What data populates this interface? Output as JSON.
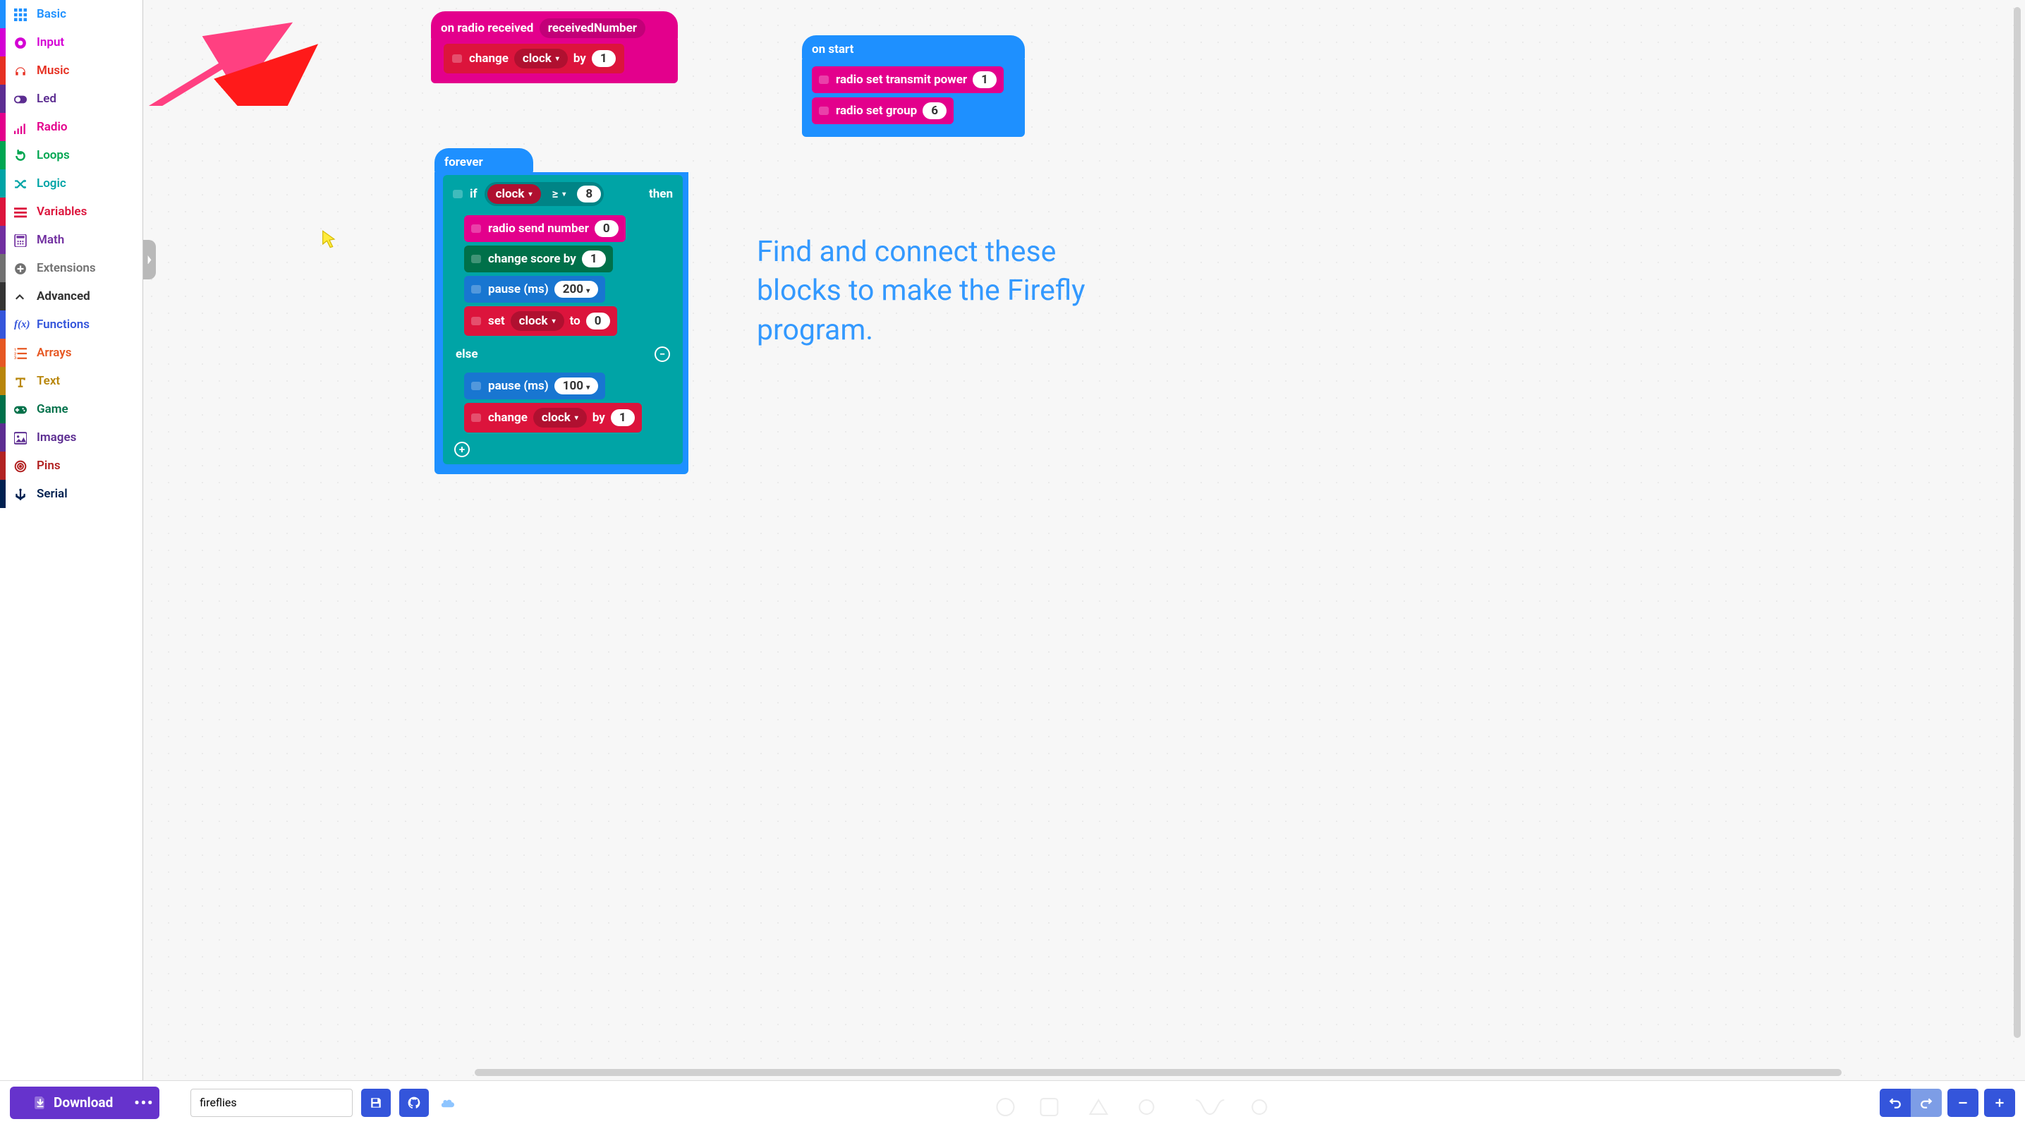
{
  "toolbox": [
    {
      "id": "basic",
      "label": "Basic"
    },
    {
      "id": "input",
      "label": "Input"
    },
    {
      "id": "music",
      "label": "Music"
    },
    {
      "id": "led",
      "label": "Led"
    },
    {
      "id": "radio",
      "label": "Radio"
    },
    {
      "id": "loops",
      "label": "Loops"
    },
    {
      "id": "logic",
      "label": "Logic"
    },
    {
      "id": "variables",
      "label": "Variables"
    },
    {
      "id": "math",
      "label": "Math"
    },
    {
      "id": "extensions",
      "label": "Extensions"
    },
    {
      "id": "advanced",
      "label": "Advanced"
    },
    {
      "id": "functions",
      "label": "Functions"
    },
    {
      "id": "arrays",
      "label": "Arrays"
    },
    {
      "id": "text",
      "label": "Text"
    },
    {
      "id": "game",
      "label": "Game"
    },
    {
      "id": "images",
      "label": "Images"
    },
    {
      "id": "pins",
      "label": "Pins"
    },
    {
      "id": "serial",
      "label": "Serial"
    }
  ],
  "blocks": {
    "onRadio": {
      "title": "on radio received",
      "param": "receivedNumber",
      "change": {
        "label": "change",
        "var": "clock",
        "by": "by",
        "val": "1"
      }
    },
    "onStart": {
      "title": "on start",
      "rows": [
        {
          "label": "radio set transmit power",
          "val": "1"
        },
        {
          "label": "radio set group",
          "val": "6"
        }
      ]
    },
    "forever": {
      "title": "forever",
      "if": "if",
      "then": "then",
      "else": "else",
      "cond": {
        "var": "clock",
        "op": "≥",
        "val": "8"
      },
      "body_if": [
        {
          "type": "radio",
          "label": "radio send number",
          "val": "0"
        },
        {
          "type": "game",
          "label": "change score by",
          "val": "1"
        },
        {
          "type": "pause",
          "label": "pause (ms)",
          "val": "200"
        },
        {
          "type": "setvar",
          "label": "set",
          "var": "clock",
          "to": "to",
          "val": "0"
        }
      ],
      "body_else": [
        {
          "type": "pause",
          "label": "pause (ms)",
          "val": "100"
        },
        {
          "type": "changevar",
          "label": "change",
          "var": "clock",
          "by": "by",
          "val": "1"
        }
      ]
    }
  },
  "instructions": "Find and connect these blocks to make the Firefly program.",
  "bottom": {
    "download": "Download",
    "project_name": "fireflies"
  }
}
